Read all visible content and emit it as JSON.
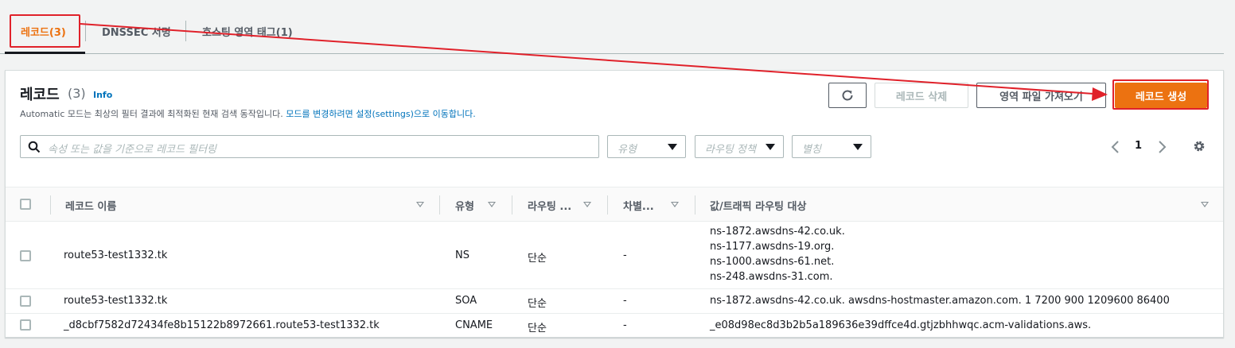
{
  "tabs": [
    {
      "label": "레코드(3)"
    },
    {
      "label": "DNSSEC 서명"
    },
    {
      "label": "호스팅 영역 태그(1)"
    }
  ],
  "panel": {
    "title": "레코드",
    "count": "(3)",
    "info": "Info",
    "desc_prefix": "Automatic 모드는 최상의 필터 결과에 최적화된 현재 검색 동작입니다.",
    "desc_link": "모드를 변경하려면 설정(settings)으로 이동합니다.",
    "buttons": {
      "delete": "레코드 삭제",
      "import": "영역 파일 가져오기",
      "create": "레코드 생성"
    },
    "search_placeholder": "속성 또는 값을 기준으로 레코드 필터링",
    "filters": [
      {
        "placeholder": "유형"
      },
      {
        "placeholder": "라우팅 정책"
      },
      {
        "placeholder": "별칭"
      }
    ],
    "page_number": "1"
  },
  "table": {
    "columns": [
      "레코드 이름",
      "유형",
      "라우팅 ...",
      "차별...",
      "값/트래픽 라우팅 대상"
    ],
    "rows": [
      {
        "name": "route53-test1332.tk",
        "type": "NS",
        "routing": "단순",
        "diff": "-",
        "values": [
          "ns-1872.awsdns-42.co.uk.",
          "ns-1177.awsdns-19.org.",
          "ns-1000.awsdns-61.net.",
          "ns-248.awsdns-31.com."
        ]
      },
      {
        "name": "route53-test1332.tk",
        "type": "SOA",
        "routing": "단순",
        "diff": "-",
        "values": [
          "ns-1872.awsdns-42.co.uk. awsdns-hostmaster.amazon.com. 1 7200 900 1209600 86400"
        ]
      },
      {
        "name": "_d8cbf7582d72434fe8b15122b8972661.route53-test1332.tk",
        "type": "CNAME",
        "routing": "단순",
        "diff": "-",
        "values": [
          "_e08d98ec8d3b2b5a189636e39dffce4d.gtjzbhhwqc.acm-validations.aws."
        ]
      }
    ]
  },
  "icons": [
    "search-icon",
    "refresh-icon",
    "chevron-left-icon",
    "chevron-right-icon",
    "gear-icon",
    "caret-down-icon",
    "sort-icon"
  ],
  "colors": {
    "accent": "#ec7211",
    "link": "#0073bb",
    "annotation": "#e0212a"
  }
}
